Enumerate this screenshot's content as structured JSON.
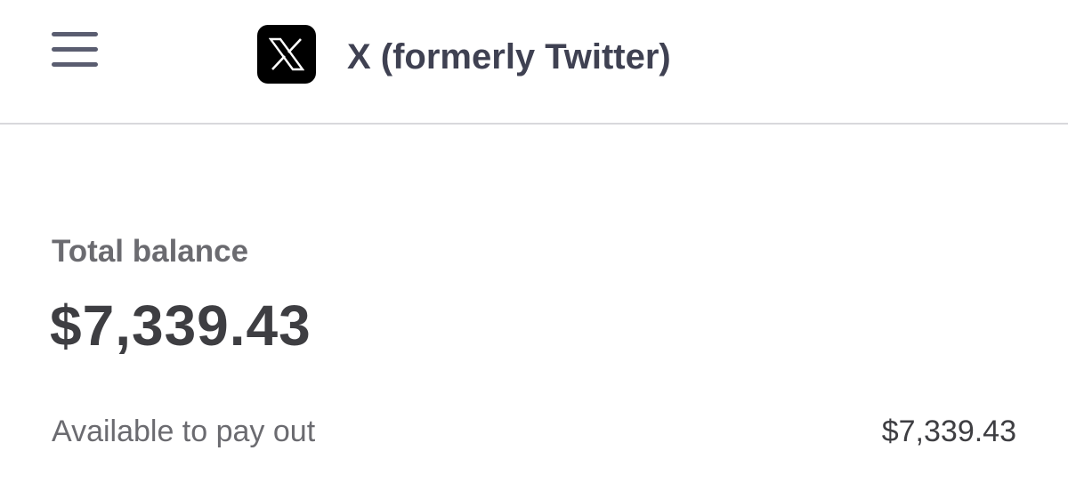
{
  "header": {
    "menu_icon": "hamburger-menu-icon",
    "app_icon": "x-logo-icon",
    "title": "X (formerly Twitter)"
  },
  "balance": {
    "label": "Total balance",
    "amount": "$7,339.43"
  },
  "payout": {
    "label": "Available to pay out",
    "amount": "$7,339.43"
  },
  "colors": {
    "title": "#3f4152",
    "menu_icon": "#5a5d70",
    "muted_text": "#6b6b70",
    "amount_text": "#3e3e42",
    "divider": "#d8d8dc",
    "logo_background": "#000000"
  }
}
